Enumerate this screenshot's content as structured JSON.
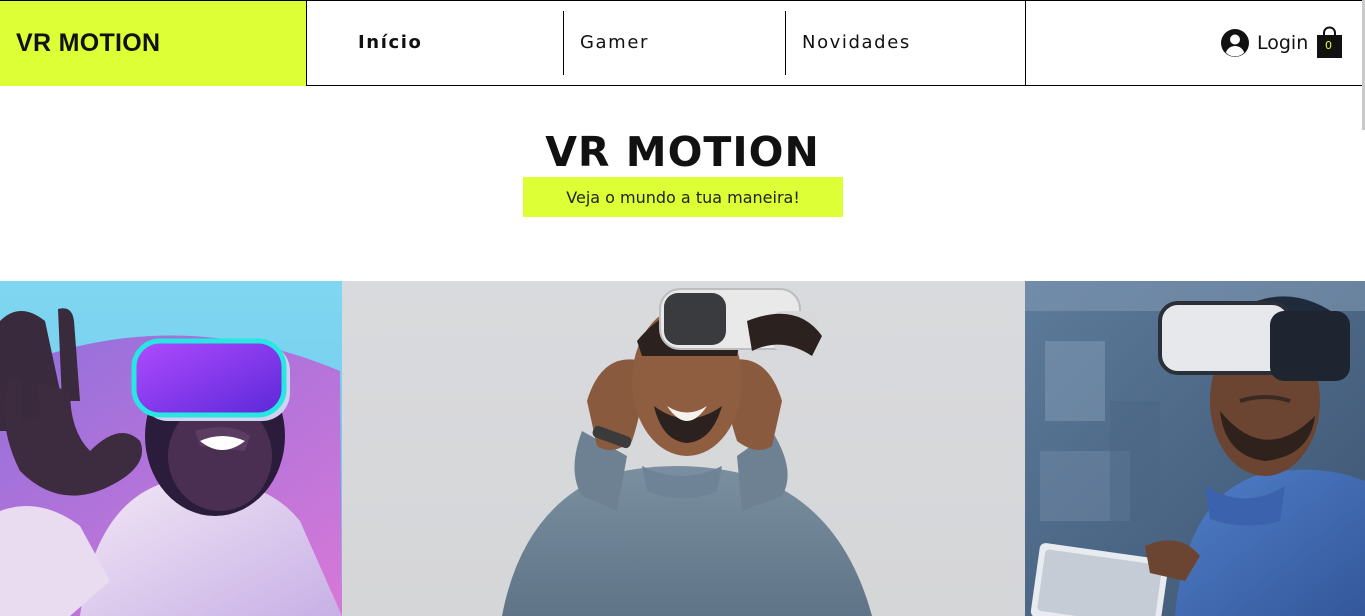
{
  "brand": {
    "logo_text": "VR MOTION"
  },
  "nav": {
    "items": [
      {
        "label": "Início",
        "active": true
      },
      {
        "label": "Gamer",
        "active": false
      },
      {
        "label": "Novidades",
        "active": false
      }
    ]
  },
  "account": {
    "login_label": "Login",
    "cart_count": "0"
  },
  "hero": {
    "title": "VR MOTION",
    "tagline": "Veja o mundo a tua maneira!"
  },
  "colors": {
    "accent": "#dcff35",
    "text": "#111111",
    "border": "#000000"
  },
  "icons": {
    "user": "user-circle-icon",
    "cart": "shopping-bag-icon"
  }
}
